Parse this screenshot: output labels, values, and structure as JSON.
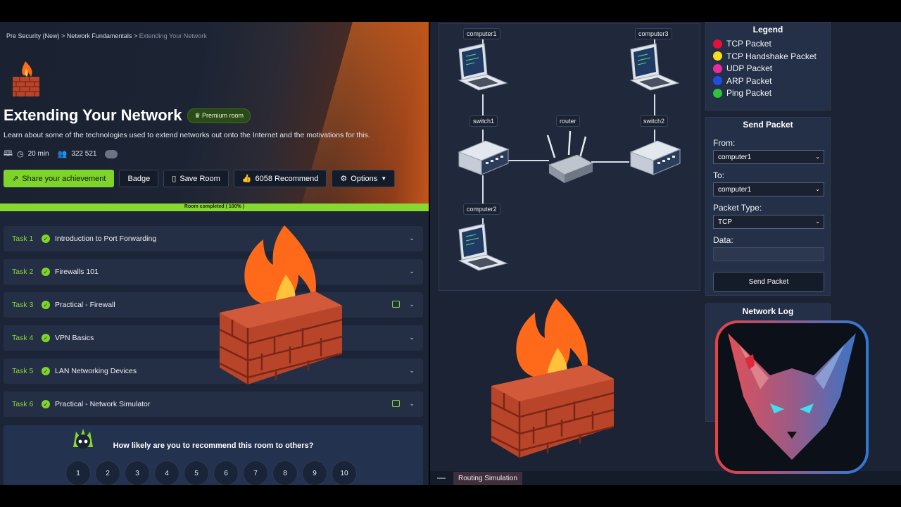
{
  "breadcrumb": {
    "items": [
      "Pre Security (New)",
      "Network Fundamentals"
    ],
    "current": "Extending Your Network",
    "sep": ">"
  },
  "room": {
    "title": "Extending Your Network",
    "premium_label": "Premium room",
    "description": "Learn about some of the technologies used to extend networks out onto the Internet and the motivations for this.",
    "duration": "20 min",
    "users": "322 521"
  },
  "actions": {
    "share": "Share your achievement",
    "badge": "Badge",
    "save": "Save Room",
    "recommend": "6058 Recommend",
    "options": "Options"
  },
  "progress": {
    "label": "Room completed ( 100% )",
    "value": 100
  },
  "tasks": [
    {
      "num": "Task 1",
      "name": "Introduction to Port Forwarding",
      "has_calendar": false
    },
    {
      "num": "Task 2",
      "name": "Firewalls 101",
      "has_calendar": false
    },
    {
      "num": "Task 3",
      "name": "Practical - Firewall",
      "has_calendar": true
    },
    {
      "num": "Task 4",
      "name": "VPN Basics",
      "has_calendar": false
    },
    {
      "num": "Task 5",
      "name": "LAN Networking Devices",
      "has_calendar": false
    },
    {
      "num": "Task 6",
      "name": "Practical - Network Simulator",
      "has_calendar": true
    }
  ],
  "survey": {
    "question": "How likely are you to recommend this room to others?",
    "scale": [
      "1",
      "2",
      "3",
      "4",
      "5",
      "6",
      "7",
      "8",
      "9",
      "10"
    ]
  },
  "network": {
    "labels": {
      "computer1": "computer1",
      "computer2": "computer2",
      "computer3": "computer3",
      "switch1": "switch1",
      "switch2": "switch2",
      "router": "router"
    }
  },
  "legend": {
    "title": "Legend",
    "items": [
      {
        "label": "TCP Packet",
        "color": "#e8103a"
      },
      {
        "label": "TCP Handshake Packet",
        "color": "#f5e11a"
      },
      {
        "label": "UDP Packet",
        "color": "#e92b9c"
      },
      {
        "label": "ARP Packet",
        "color": "#1c4fe0"
      },
      {
        "label": "Ping Packet",
        "color": "#2fc23a"
      }
    ]
  },
  "send_packet": {
    "title": "Send Packet",
    "from_label": "From:",
    "from_value": "computer1",
    "to_label": "To:",
    "to_value": "computer1",
    "type_label": "Packet Type:",
    "type_value": "TCP",
    "data_label": "Data:",
    "button": "Send Packet"
  },
  "network_log": {
    "title": "Network Log"
  },
  "bottom": {
    "minimize": "—",
    "tab": "Routing Simulation"
  }
}
